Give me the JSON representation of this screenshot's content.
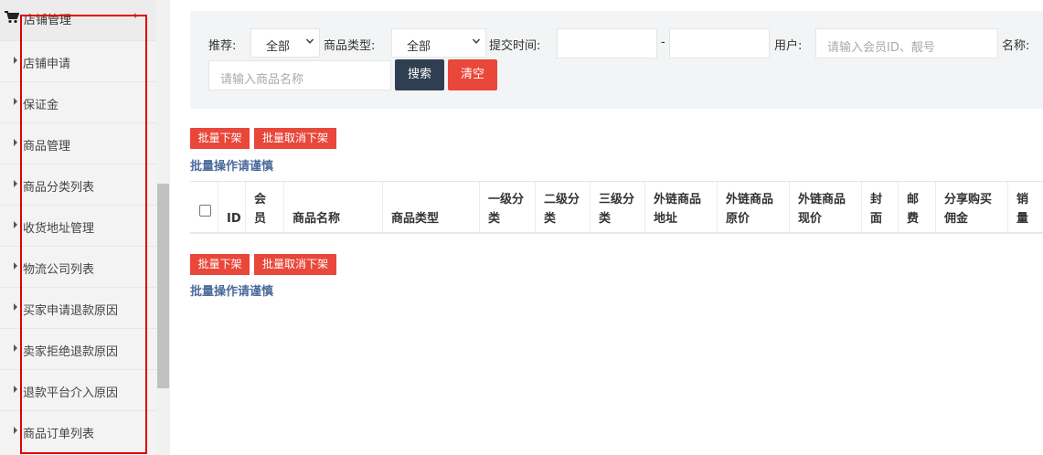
{
  "sidebar": {
    "header": {
      "title": "店铺管理",
      "icon": "cart-icon",
      "arrow": "›"
    },
    "items": [
      {
        "label": "店铺申请"
      },
      {
        "label": "保证金"
      },
      {
        "label": "商品管理"
      },
      {
        "label": "商品分类列表"
      },
      {
        "label": "收货地址管理"
      },
      {
        "label": "物流公司列表"
      },
      {
        "label": "买家申请退款原因"
      },
      {
        "label": "卖家拒绝退款原因"
      },
      {
        "label": "退款平台介入原因"
      },
      {
        "label": "商品订单列表"
      }
    ]
  },
  "filter": {
    "recommend_label": "推荐:",
    "recommend_value": "全部",
    "type_label": "商品类型:",
    "type_value": "全部",
    "time_label": "提交时间:",
    "time_sep": "-",
    "user_label": "用户:",
    "user_placeholder": "请输入会员ID、靓号",
    "name_label": "名称:",
    "name_placeholder": "请输入商品名称",
    "search_button": "搜索",
    "clear_button": "清空"
  },
  "batch": {
    "offshelf": "批量下架",
    "cancel_offshelf": "批量取消下架",
    "warning": "批量操作请谨慎"
  },
  "table": {
    "columns": [
      {
        "l1": "ID",
        "l2": ""
      },
      {
        "l1": "会",
        "l2": "员"
      },
      {
        "l1": "商品名称",
        "l2": ""
      },
      {
        "l1": "商品类型",
        "l2": ""
      },
      {
        "l1": "一级分",
        "l2": "类"
      },
      {
        "l1": "二级分",
        "l2": "类"
      },
      {
        "l1": "三级分",
        "l2": "类"
      },
      {
        "l1": "外链商品",
        "l2": "地址"
      },
      {
        "l1": "外链商品",
        "l2": "原价"
      },
      {
        "l1": "外链商品",
        "l2": "现价"
      },
      {
        "l1": "封",
        "l2": "面"
      },
      {
        "l1": "邮",
        "l2": "费"
      },
      {
        "l1": "分享购买",
        "l2": "佣金"
      },
      {
        "l1": "销",
        "l2": "量"
      }
    ]
  },
  "colors": {
    "accent_red": "#e8473a",
    "dark_button": "#2f3e50",
    "warn_text": "#4b6b9b",
    "highlight_box": "#e00000"
  }
}
